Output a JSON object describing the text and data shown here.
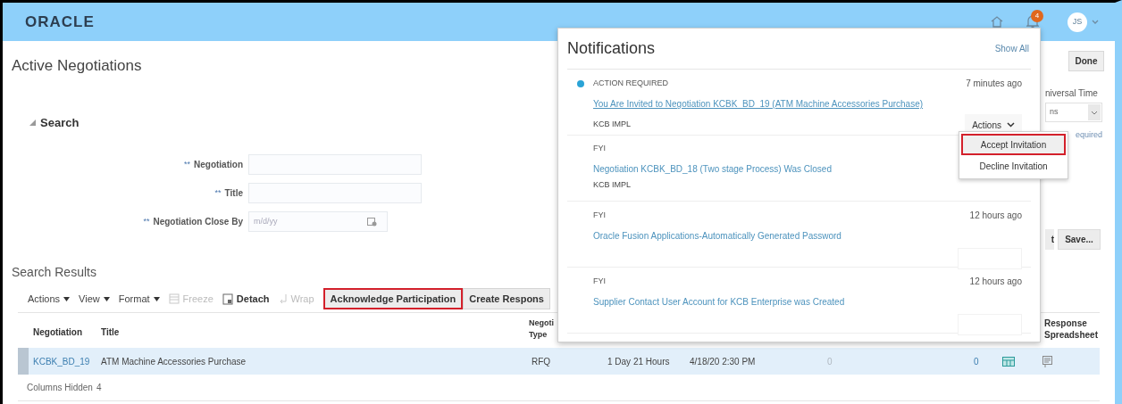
{
  "header": {
    "logo": "ORACLE",
    "badge": "4",
    "avatar": "JS"
  },
  "page_title": "Active Negotiations",
  "search": {
    "heading": "Search",
    "expanded": true,
    "fields": [
      {
        "mark": "**",
        "label": "Negotiation",
        "kind": "text"
      },
      {
        "mark": "**",
        "label": "Title",
        "kind": "text"
      },
      {
        "mark": "**",
        "label": "Negotiation Close By",
        "kind": "date",
        "placeholder": "m/d/yy"
      }
    ]
  },
  "results": {
    "title": "Search Results",
    "toolbar": [
      {
        "label": "Actions",
        "kind": "menu",
        "disabled": false
      },
      {
        "label": "View",
        "kind": "menu",
        "disabled": false
      },
      {
        "label": "Format",
        "kind": "menu",
        "disabled": false
      },
      {
        "label": "Freeze",
        "kind": "freeze",
        "disabled": true
      },
      {
        "label": "Detach",
        "kind": "detach",
        "disabled": false
      },
      {
        "label": "Wrap",
        "kind": "wrap",
        "disabled": true
      },
      {
        "label": "Acknowledge Participation",
        "kind": "button",
        "highlighted": true
      },
      {
        "label": "Create Respons",
        "kind": "button",
        "highlighted": false
      }
    ]
  },
  "table": {
    "columns": [
      {
        "lines": [
          "Negotiation"
        ]
      },
      {
        "lines": [
          "Title"
        ]
      },
      {
        "lines": [
          "Negoti",
          "Type"
        ]
      },
      {
        "lines": [
          "Response",
          "Spreadsheet"
        ]
      }
    ],
    "rows": [
      {
        "selected": true,
        "cells": [
          {
            "kind": "link",
            "text": "KCBK_BD_19"
          },
          {
            "kind": "text",
            "text": "ATM Machine Accessories Purchase"
          },
          {
            "kind": "text",
            "text": "RFQ"
          },
          {
            "kind": "text",
            "text": "1 Day 21 Hours"
          },
          {
            "kind": "text",
            "text": "4/18/20 2:30 PM"
          },
          {
            "kind": "faint",
            "text": "0"
          },
          {
            "kind": "link",
            "text": "0"
          },
          {
            "kind": "table-icon"
          },
          {
            "kind": "report-icon"
          }
        ]
      }
    ],
    "footer_label": "Columns Hidden",
    "footer_count": "4"
  },
  "right_fragments": {
    "done": "Done",
    "timezone_label": "niversal Time",
    "timezone_value": "ns",
    "required_note": "equired",
    "cut_button": "t",
    "save": "Save..."
  },
  "notifications": {
    "title": "Notifications",
    "show_all": "Show All",
    "items": [
      {
        "unread": true,
        "category": "ACTION REQUIRED",
        "time": "7 minutes ago",
        "title": "You Are Invited to Negotiation KCBK_BD_19 (ATM Machine Accessories Purchase)",
        "underlined": true,
        "company": "KCB IMPL",
        "actions": "Actions",
        "faint_button": false
      },
      {
        "unread": false,
        "category": "FYI",
        "title": "Negotiation KCBK_BD_18 (Two stage Process) Was Closed",
        "underlined": false,
        "company": "KCB IMPL",
        "faint_button": false
      },
      {
        "unread": false,
        "category": "FYI",
        "time": "12 hours ago",
        "title": "Oracle Fusion Applications-Automatically Generated Password",
        "underlined": false,
        "faint_button": true
      },
      {
        "unread": false,
        "category": "FYI",
        "time": "12 hours ago",
        "title": "Supplier Contact User Account for KCB Enterprise was Created",
        "underlined": false,
        "faint_button": true
      }
    ]
  },
  "actions_menu": [
    {
      "label": "Accept Invitation",
      "highlighted": true
    },
    {
      "label": "Decline Invitation",
      "highlighted": false
    }
  ]
}
